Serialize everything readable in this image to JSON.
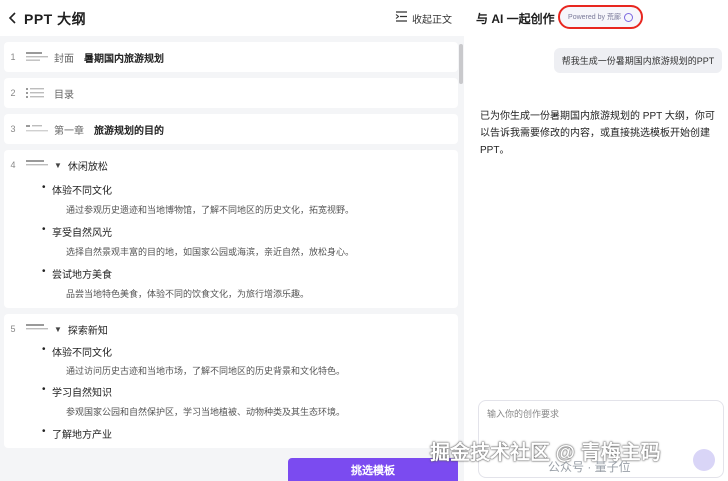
{
  "left": {
    "title": "PPT 大纲",
    "collapse_label": "收起正文",
    "select_button": "挑选模板"
  },
  "outline": [
    {
      "num": "1",
      "label": "封面",
      "text": "暑期国内旅游规划"
    },
    {
      "num": "2",
      "label": "目录",
      "text": ""
    },
    {
      "num": "3",
      "label": "第一章",
      "text": "旅游规划的目的"
    }
  ],
  "sections": [
    {
      "num": "4",
      "title": "休闲放松",
      "items": [
        {
          "title": "体验不同文化",
          "desc": "通过参观历史遗迹和当地博物馆，了解不同地区的历史文化，拓宽视野。"
        },
        {
          "title": "享受自然风光",
          "desc": "选择自然景观丰富的目的地，如国家公园或海滨，亲近自然，放松身心。"
        },
        {
          "title": "尝试地方美食",
          "desc": "品尝当地特色美食，体验不同的饮食文化，为旅行增添乐趣。"
        }
      ]
    },
    {
      "num": "5",
      "title": "探索新知",
      "items": [
        {
          "title": "体验不同文化",
          "desc": "通过访问历史古迹和当地市场，了解不同地区的历史背景和文化特色。"
        },
        {
          "title": "学习自然知识",
          "desc": "参观国家公园和自然保护区，学习当地植被、动物种类及其生态环境。"
        },
        {
          "title": "了解地方产业",
          "desc": ""
        }
      ]
    }
  ],
  "right": {
    "title": "与 AI 一起创作",
    "powered_by": "Powered by 荒廊",
    "user_message": "帮我生成一份暑期国内旅游规划的PPT",
    "ai_message": "已为你生成一份暑期国内旅游规划的 PPT 大纲，你可以告诉我需要修改的内容，或直接挑选模板开始创建PPT。",
    "input_placeholder": "输入你的创作要求"
  },
  "watermark": {
    "main": "掘金技术社区 @ 青梅主码",
    "sub": "公众号 · 量子位"
  },
  "colors": {
    "accent": "#7b4bf0",
    "highlight_ring": "#e8261f"
  }
}
